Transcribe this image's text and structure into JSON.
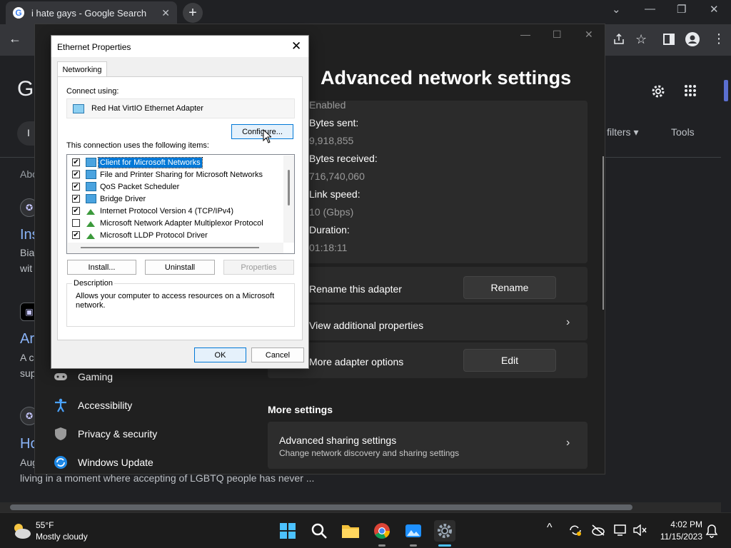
{
  "browser": {
    "tab_title": "i hate gays - Google Search",
    "tab_close": "✕",
    "new_tab": "+",
    "window_controls": [
      "⌄",
      "—",
      "❐",
      "✕"
    ],
    "back": "←",
    "page": {
      "logo_letter": "G",
      "all_filters": "ll filters ▾",
      "tools": "Tools",
      "about": "Abo",
      "results": [
        {
          "link": "Ins",
          "snippet_1": "Bia",
          "snippet_2": "wit"
        },
        {
          "link": "Ar",
          "snippet_1": "A c",
          "snippet_2": "sup"
        },
        {
          "link": "Ho",
          "snippet_1": "Aug",
          "snippet_2": "living in a moment where accepting of LGBTQ people has never ..."
        }
      ]
    }
  },
  "settings": {
    "title": "Advanced network settings",
    "window_controls": [
      "—",
      "☐",
      "✕"
    ],
    "properties": [
      {
        "label": "",
        "value": "Enabled"
      },
      {
        "label": "Bytes sent:",
        "value": "9,918,855"
      },
      {
        "label": "Bytes received:",
        "value": "716,740,060"
      },
      {
        "label": "Link speed:",
        "value": "10 (Gbps)"
      },
      {
        "label": "Duration:",
        "value": "01:18:11"
      }
    ],
    "rename_label": "Rename this adapter",
    "rename_button": "Rename",
    "view_props_label": "View additional properties",
    "more_options_label": "More adapter options",
    "edit_button": "Edit",
    "more_settings": "More settings",
    "sharing_title": "Advanced sharing settings",
    "sharing_sub": "Change network discovery and sharing settings",
    "chevron": "›",
    "nav": [
      "Gaming",
      "Accessibility",
      "Privacy & security",
      "Windows Update"
    ]
  },
  "dialog": {
    "title": "Ethernet Properties",
    "close": "✕",
    "tab": "Networking",
    "connect_using": "Connect using:",
    "adapter": "Red Hat VirtIO Ethernet Adapter",
    "configure": "Configure...",
    "items_label": "This connection uses the following items:",
    "items": [
      {
        "label": "Client for Microsoft Networks",
        "checked": true,
        "selected": true,
        "icon": "client"
      },
      {
        "label": "File and Printer Sharing for Microsoft Networks",
        "checked": true,
        "selected": false,
        "icon": "client"
      },
      {
        "label": "QoS Packet Scheduler",
        "checked": true,
        "selected": false,
        "icon": "client"
      },
      {
        "label": "Bridge Driver",
        "checked": true,
        "selected": false,
        "icon": "client"
      },
      {
        "label": "Internet Protocol Version 4 (TCP/IPv4)",
        "checked": true,
        "selected": false,
        "icon": "protocol"
      },
      {
        "label": "Microsoft Network Adapter Multiplexor Protocol",
        "checked": false,
        "selected": false,
        "icon": "protocol"
      },
      {
        "label": "Microsoft LLDP Protocol Driver",
        "checked": true,
        "selected": false,
        "icon": "protocol"
      }
    ],
    "install": "Install...",
    "uninstall": "Uninstall",
    "properties": "Properties",
    "description_legend": "Description",
    "description_text": "Allows your computer to access resources on a Microsoft network.",
    "ok": "OK",
    "cancel": "Cancel"
  },
  "taskbar": {
    "temp": "55°F",
    "weather": "Mostly cloudy",
    "time": "4:02 PM",
    "date": "11/15/2023",
    "tray_chevron": "^",
    "bell": "🔔"
  },
  "colors": {
    "accent": "#0078d7",
    "link": "#8ab4f8",
    "settings_bg": "#202020"
  }
}
